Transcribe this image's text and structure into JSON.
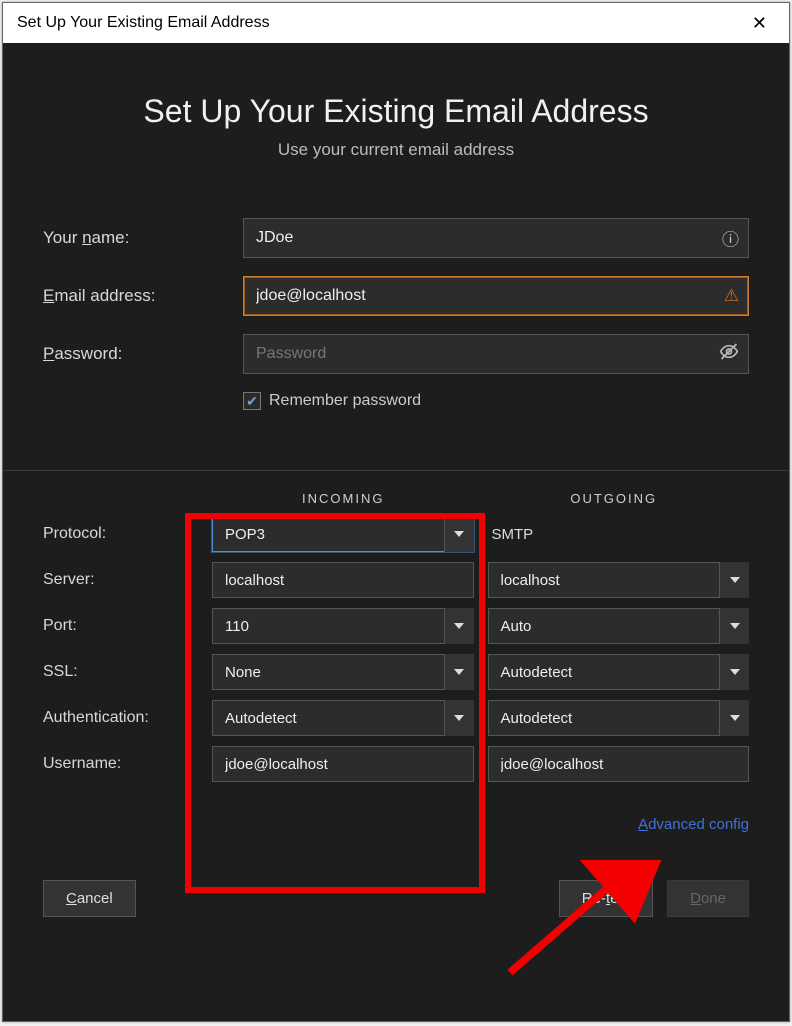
{
  "window": {
    "title": "Set Up Your Existing Email Address"
  },
  "header": {
    "title": "Set Up Your Existing Email Address",
    "subtitle": "Use your current email address"
  },
  "form": {
    "name_label": "Your name:",
    "name_value": "JDoe",
    "email_label": "Email address:",
    "email_value": "jdoe@localhost",
    "password_label": "Password:",
    "password_placeholder": "Password",
    "password_value": "",
    "remember_label": "Remember password",
    "remember_checked": true
  },
  "config": {
    "incoming_header": "INCOMING",
    "outgoing_header": "OUTGOING",
    "rows": {
      "protocol": {
        "label": "Protocol:",
        "incoming": "POP3",
        "outgoing": "SMTP"
      },
      "server": {
        "label": "Server:",
        "incoming": "localhost",
        "outgoing": "localhost"
      },
      "port": {
        "label": "Port:",
        "incoming": "110",
        "outgoing": "Auto"
      },
      "ssl": {
        "label": "SSL:",
        "incoming": "None",
        "outgoing": "Autodetect"
      },
      "auth": {
        "label": "Authentication:",
        "incoming": "Autodetect",
        "outgoing": "Autodetect"
      },
      "username": {
        "label": "Username:",
        "incoming": "jdoe@localhost",
        "outgoing": "jdoe@localhost"
      }
    },
    "advanced_link": "Advanced config"
  },
  "footer": {
    "cancel": "Cancel",
    "retest": "Re-test",
    "done": "Done"
  }
}
